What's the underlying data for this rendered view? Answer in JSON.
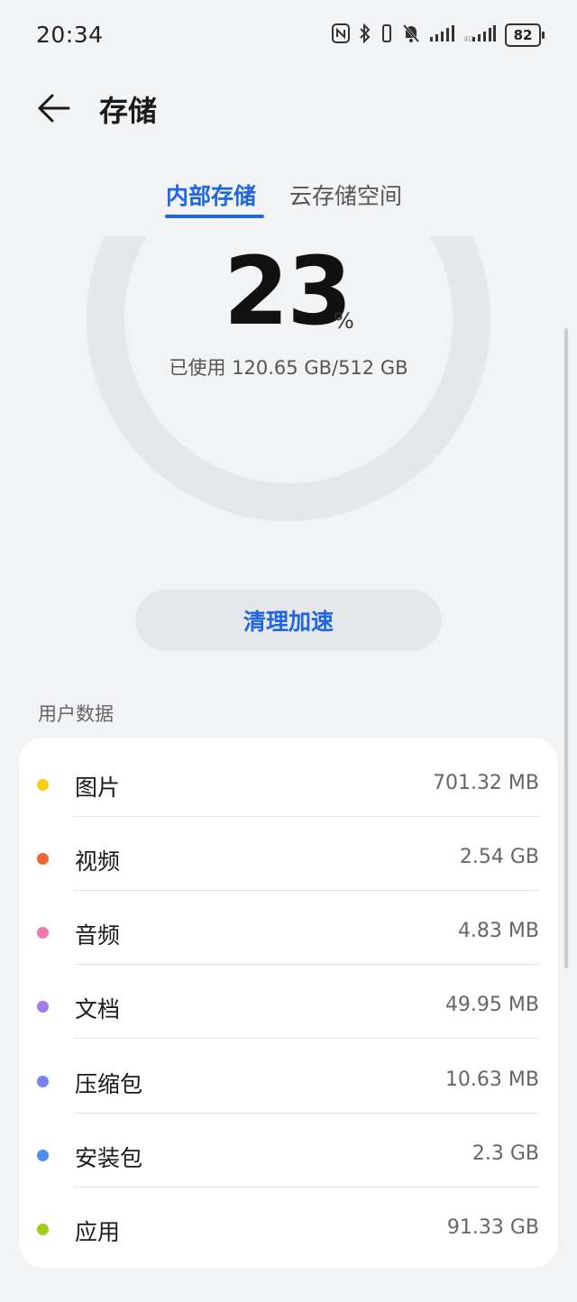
{
  "status_bar": {
    "time": "20:34",
    "battery": "82",
    "icons": [
      "nfc-icon",
      "bluetooth-icon",
      "vibrate-icon",
      "mute-bell-icon",
      "signal-icon",
      "signal-icon-2"
    ]
  },
  "header": {
    "title": "存储",
    "back_icon": "back-arrow-icon"
  },
  "tabs": [
    {
      "label": "内部存储",
      "active": true
    },
    {
      "label": "云存储空间",
      "active": false
    }
  ],
  "gauge": {
    "percent": "23",
    "percent_sign": "%",
    "used_text": "已使用 120.65 GB/512 GB",
    "used_fraction": 0.23
  },
  "clean_button": {
    "label": "清理加速"
  },
  "section": {
    "title": "用户数据"
  },
  "items": [
    {
      "label": "图片",
      "value": "701.32 MB",
      "color": "#f5cf10"
    },
    {
      "label": "视频",
      "value": "2.54 GB",
      "color": "#ef6533"
    },
    {
      "label": "音频",
      "value": "4.83 MB",
      "color": "#f277b2"
    },
    {
      "label": "文档",
      "value": "49.95 MB",
      "color": "#a478e8"
    },
    {
      "label": "压缩包",
      "value": "10.63 MB",
      "color": "#7d7ff0"
    },
    {
      "label": "安装包",
      "value": "2.3 GB",
      "color": "#4a8ef3"
    },
    {
      "label": "应用",
      "value": "91.33 GB",
      "color": "#9ccf1e"
    }
  ],
  "colors": {
    "accent": "#1f66e0",
    "background": "#f1f3f5",
    "ring_track": "#e6e7e9",
    "ring_used": "#62d34a"
  }
}
